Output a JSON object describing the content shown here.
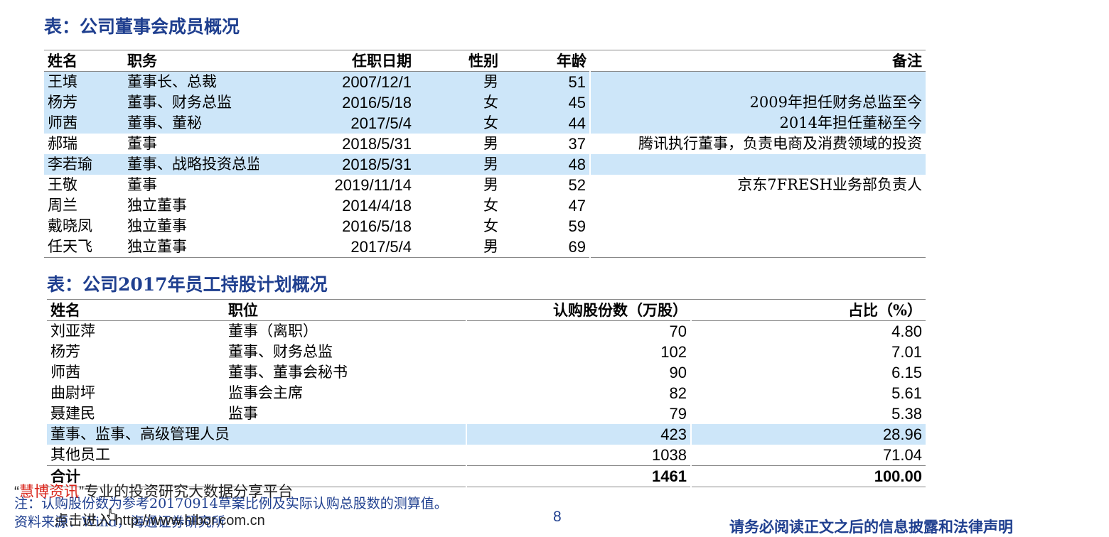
{
  "table1": {
    "caption": "表：公司董事会成员概况",
    "headers": [
      "姓名",
      "职务",
      "任职日期",
      "性别",
      "年龄",
      "备注"
    ],
    "rows": [
      {
        "name": "王填",
        "role": "董事长、总裁",
        "date": "2007/12/1",
        "sex": "男",
        "age": "51",
        "note": "",
        "hl": true
      },
      {
        "name": "杨芳",
        "role": "董事、财务总监",
        "date": "2016/5/18",
        "sex": "女",
        "age": "45",
        "note": "2009年担任财务总监至今",
        "hl": true
      },
      {
        "name": "师茜",
        "role": "董事、董秘",
        "date": "2017/5/4",
        "sex": "女",
        "age": "44",
        "note": "2014年担任董秘至今",
        "hl": true
      },
      {
        "name": "郝瑞",
        "role": "董事",
        "date": "2018/5/31",
        "sex": "男",
        "age": "37",
        "note": "腾讯执行董事，负责电商及消费领域的投资",
        "hl": false
      },
      {
        "name": "李若瑜",
        "role": "董事、战略投资总监",
        "date": "2018/5/31",
        "sex": "男",
        "age": "48",
        "note": "",
        "hl": true
      },
      {
        "name": "王敬",
        "role": "董事",
        "date": "2019/11/14",
        "sex": "男",
        "age": "52",
        "note": "京东7FRESH业务部负责人",
        "hl": false
      },
      {
        "name": "周兰",
        "role": "独立董事",
        "date": "2014/4/18",
        "sex": "女",
        "age": "47",
        "note": "",
        "hl": false
      },
      {
        "name": "戴晓凤",
        "role": "独立董事",
        "date": "2016/5/18",
        "sex": "女",
        "age": "59",
        "note": "",
        "hl": false
      },
      {
        "name": "任天飞",
        "role": "独立董事",
        "date": "2017/5/4",
        "sex": "男",
        "age": "69",
        "note": "",
        "hl": false
      }
    ]
  },
  "table2": {
    "caption": "表：公司2017年员工持股计划概况",
    "headers": [
      "姓名",
      "职位",
      "认购股份数（万股）",
      "占比（%）"
    ],
    "rows": [
      {
        "name": "刘亚萍",
        "position": "董事（离职）",
        "shares": "70",
        "ratio": "4.80",
        "type": "normal"
      },
      {
        "name": "杨芳",
        "position": "董事、财务总监",
        "shares": "102",
        "ratio": "7.01",
        "type": "normal"
      },
      {
        "name": "师茜",
        "position": "董事、董事会秘书",
        "shares": "90",
        "ratio": "6.15",
        "type": "normal"
      },
      {
        "name": "曲尉坪",
        "position": "监事会主席",
        "shares": "82",
        "ratio": "5.61",
        "type": "normal"
      },
      {
        "name": "聂建民",
        "position": "监事",
        "shares": "79",
        "ratio": "5.38",
        "type": "normal"
      },
      {
        "name": "董事、监事、高级管理人员",
        "position": "",
        "shares": "423",
        "ratio": "28.96",
        "type": "hl"
      },
      {
        "name": "其他员工",
        "position": "",
        "shares": "1038",
        "ratio": "71.04",
        "type": "normal"
      },
      {
        "name": "合计",
        "position": "",
        "shares": "1461",
        "ratio": "100.00",
        "type": "total"
      }
    ]
  },
  "footer": {
    "note": "注：认购股份数为参考20170914草案比例及实际认购总股数的测算值。",
    "source": "资料来源：Wind，海通证券研究所",
    "watermark_quote_open": "“",
    "watermark_brand": "慧博资讯",
    "watermark_rest": "”专业的投资研究大数据分享平台",
    "watermark_link": "点击进入 http://www.hibor.com.cn",
    "page_number": "8",
    "disclaimer": "请务必阅读正文之后的信息披露和法律声明"
  },
  "colors": {
    "highlight": "#cde6f9",
    "caption": "#1f3f8f",
    "brand": "#d9261c"
  }
}
